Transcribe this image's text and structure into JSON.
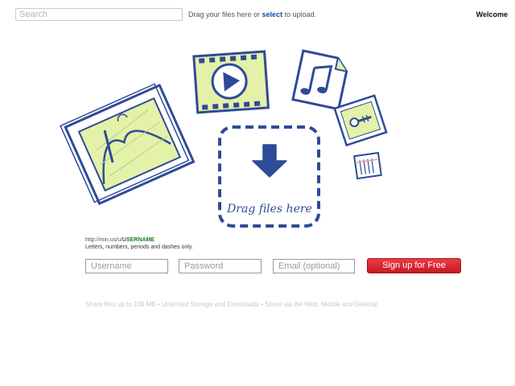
{
  "header": {
    "search_placeholder": "Search",
    "drag_prefix": "Drag your files here or ",
    "drag_link": "select",
    "drag_suffix": " to upload.",
    "welcome": "Welcome"
  },
  "dropzone": {
    "label": "Drag files here"
  },
  "signup": {
    "url_prefix": "http://min.us/u/",
    "url_username": "USERNAME",
    "username_rules": "Letters, numbers, periods and dashes only.",
    "username_placeholder": "Username",
    "password_placeholder": "Password",
    "email_placeholder": "Email (optional)",
    "submit_label": "Sign up for Free"
  },
  "footer": {
    "features": "Share files up to 100 MB • Unlimited Storage and Downloads • Share via the Web, Mobile and Desktop"
  },
  "colors": {
    "sketch_blue": "#2f4b97",
    "highlight_green": "#e4f1a8",
    "button_red": "#d8262e",
    "link_blue": "#1a4a9c"
  },
  "icons": [
    "image-file-icon",
    "video-file-icon",
    "music-file-icon",
    "archive-file-icon",
    "document-file-icon",
    "download-arrow-icon"
  ]
}
